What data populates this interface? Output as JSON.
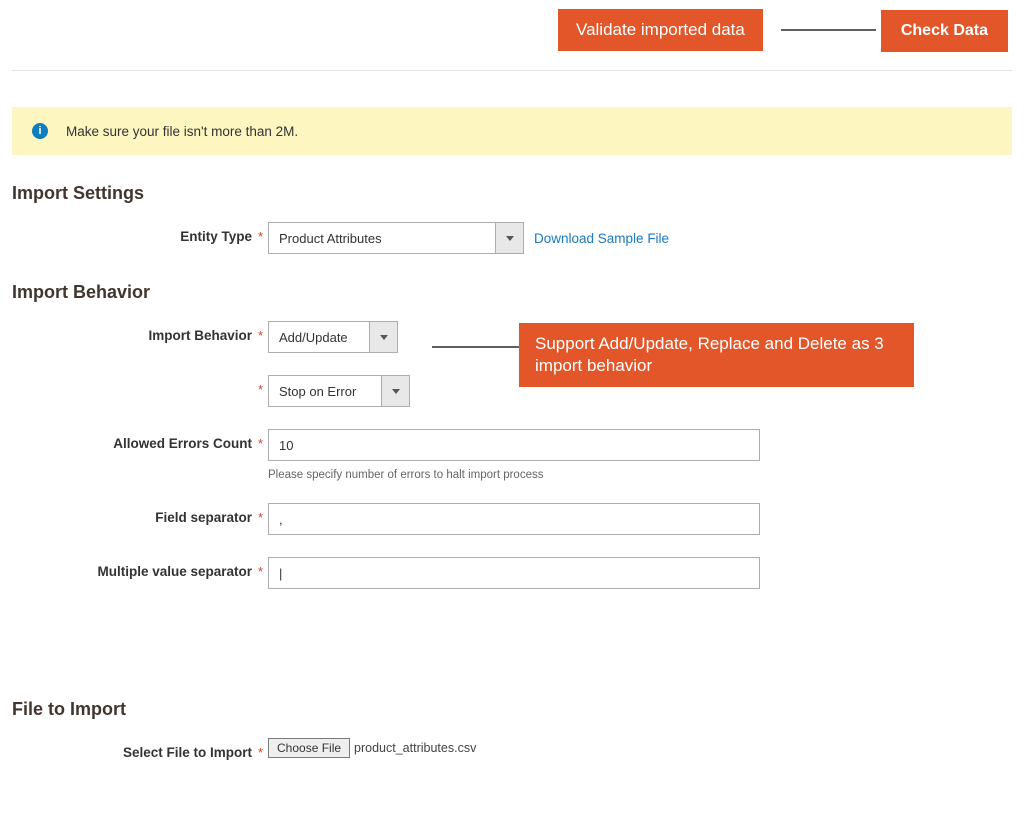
{
  "topbar": {
    "validate_callout": "Validate imported data",
    "check_data_button": "Check Data"
  },
  "notice": {
    "text": "Make sure your file isn't more than 2M."
  },
  "sections": {
    "import_settings": {
      "title": "Import Settings",
      "entity_type": {
        "label": "Entity Type",
        "value": "Product Attributes",
        "download_link": "Download Sample File"
      }
    },
    "import_behavior": {
      "title": "Import Behavior",
      "behavior": {
        "label": "Import Behavior",
        "value": "Add/Update",
        "callout": "Support Add/Update, Replace and Delete as 3 import behavior"
      },
      "error_strategy": {
        "value": "Stop on Error"
      },
      "allowed_errors": {
        "label": "Allowed Errors Count",
        "value": "10",
        "hint": "Please specify number of errors to halt import process"
      },
      "field_sep": {
        "label": "Field separator",
        "value": ","
      },
      "multi_sep": {
        "label": "Multiple value separator",
        "value": "|"
      }
    },
    "file_to_import": {
      "title": "File to Import",
      "select_file": {
        "label": "Select File to Import",
        "button": "Choose File",
        "filename": "product_attributes.csv"
      }
    }
  },
  "asterisk": "*"
}
